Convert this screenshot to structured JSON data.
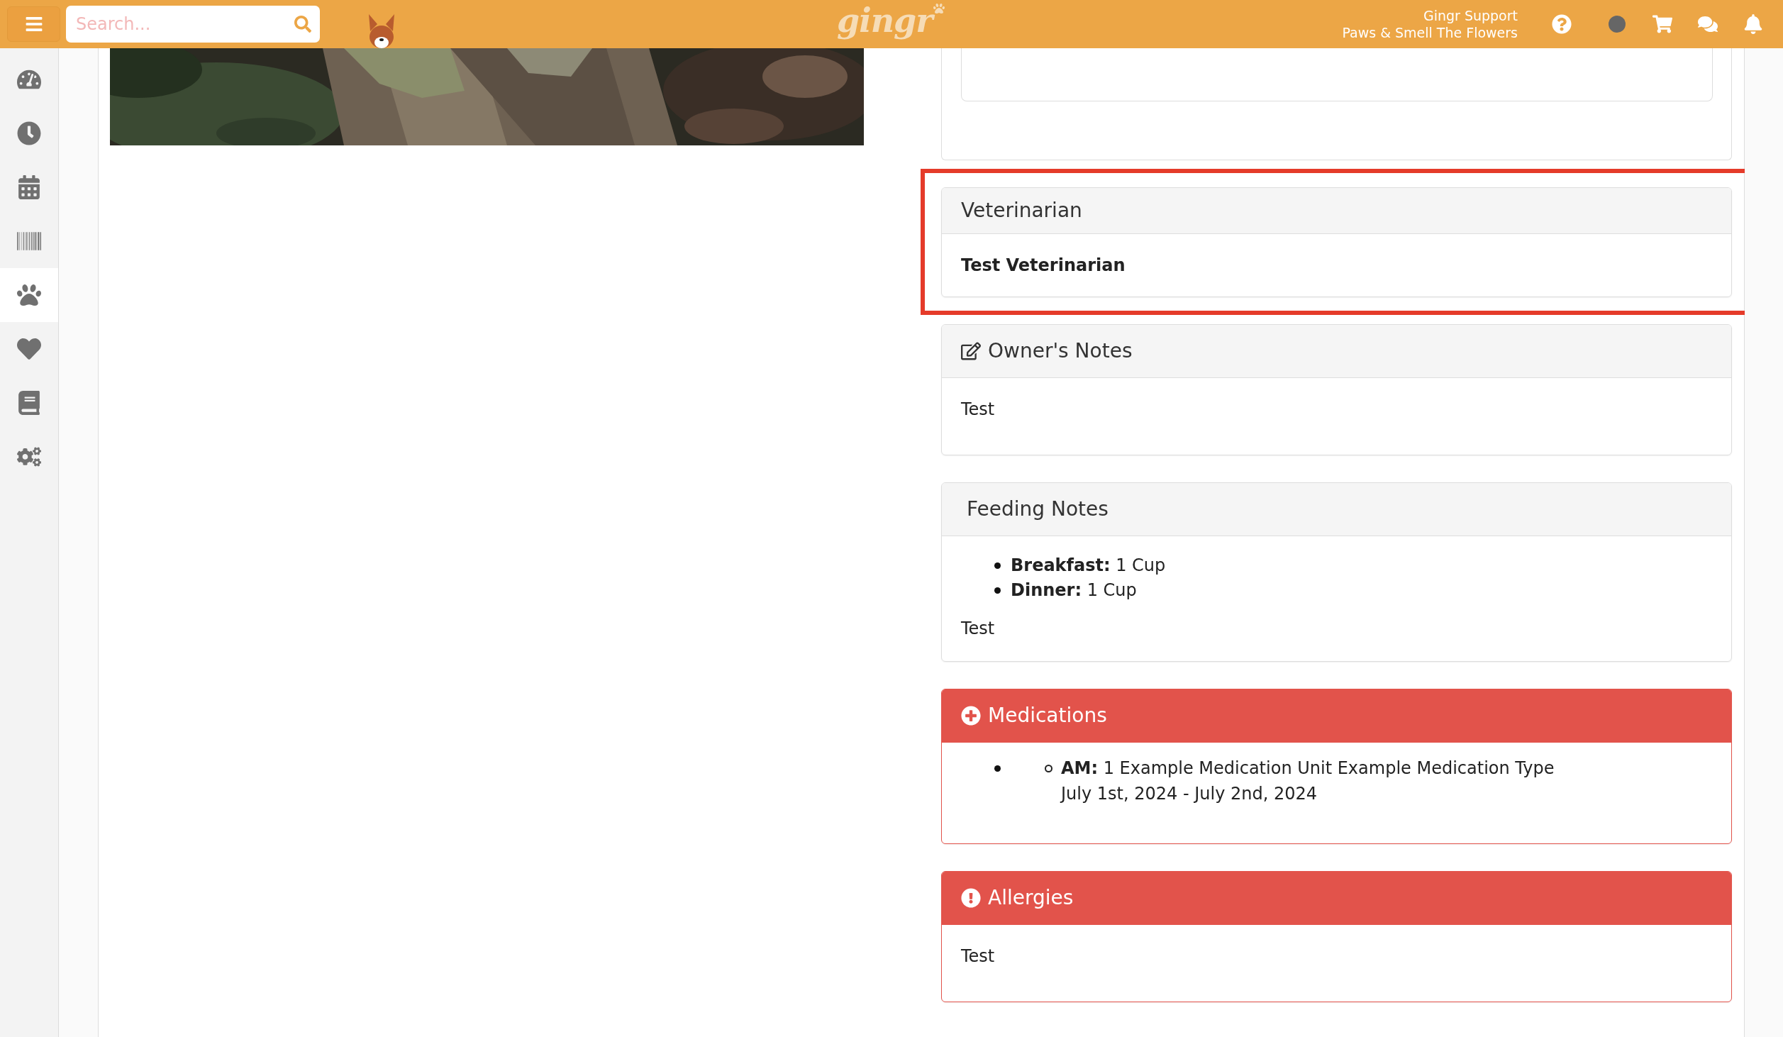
{
  "topbar": {
    "search": {
      "placeholder": "Search..."
    },
    "logo": "gingr",
    "user": {
      "name": "Gingr Support",
      "location": "Paws & Smell The Flowers"
    }
  },
  "sidebar": {
    "items": [
      {
        "selected": false
      },
      {
        "selected": false
      },
      {
        "selected": false
      },
      {
        "selected": false
      },
      {
        "selected": true
      },
      {
        "selected": false
      },
      {
        "selected": false
      },
      {
        "selected": false
      }
    ]
  },
  "cards": [
    {
      "kind": "veterinarian",
      "highlighted": true,
      "title": "Veterinarian",
      "body": [
        {
          "kind": "strong",
          "text": "Test Veterinarian"
        }
      ]
    },
    {
      "kind": "owner_notes",
      "highlighted": false,
      "title": "Owner's Notes",
      "body": [
        {
          "kind": "text",
          "text": "Test"
        }
      ]
    },
    {
      "kind": "feeding",
      "highlighted": false,
      "title": "Feeding Notes",
      "body": [
        {
          "kind": "list",
          "items": [
            {
              "text": "**Breakfast:** 1 Cup"
            },
            {
              "text": "**Dinner:** 1 Cup"
            }
          ]
        },
        {
          "kind": "text",
          "text": "Test"
        }
      ]
    },
    {
      "kind": "medications",
      "highlighted": false,
      "title": "Medications",
      "body": [
        {
          "kind": "nested_list",
          "items": [
            {
              "children": [
                {
                  "text": "**AM:** 1 Example Medication Unit Example Medication Type",
                  "note": "July 1st, 2024 - July 2nd, 2024"
                }
              ]
            }
          ]
        }
      ]
    },
    {
      "kind": "allergies",
      "highlighted": false,
      "title": "Allergies",
      "body": [
        {
          "kind": "text",
          "text": "Test"
        }
      ]
    }
  ]
}
